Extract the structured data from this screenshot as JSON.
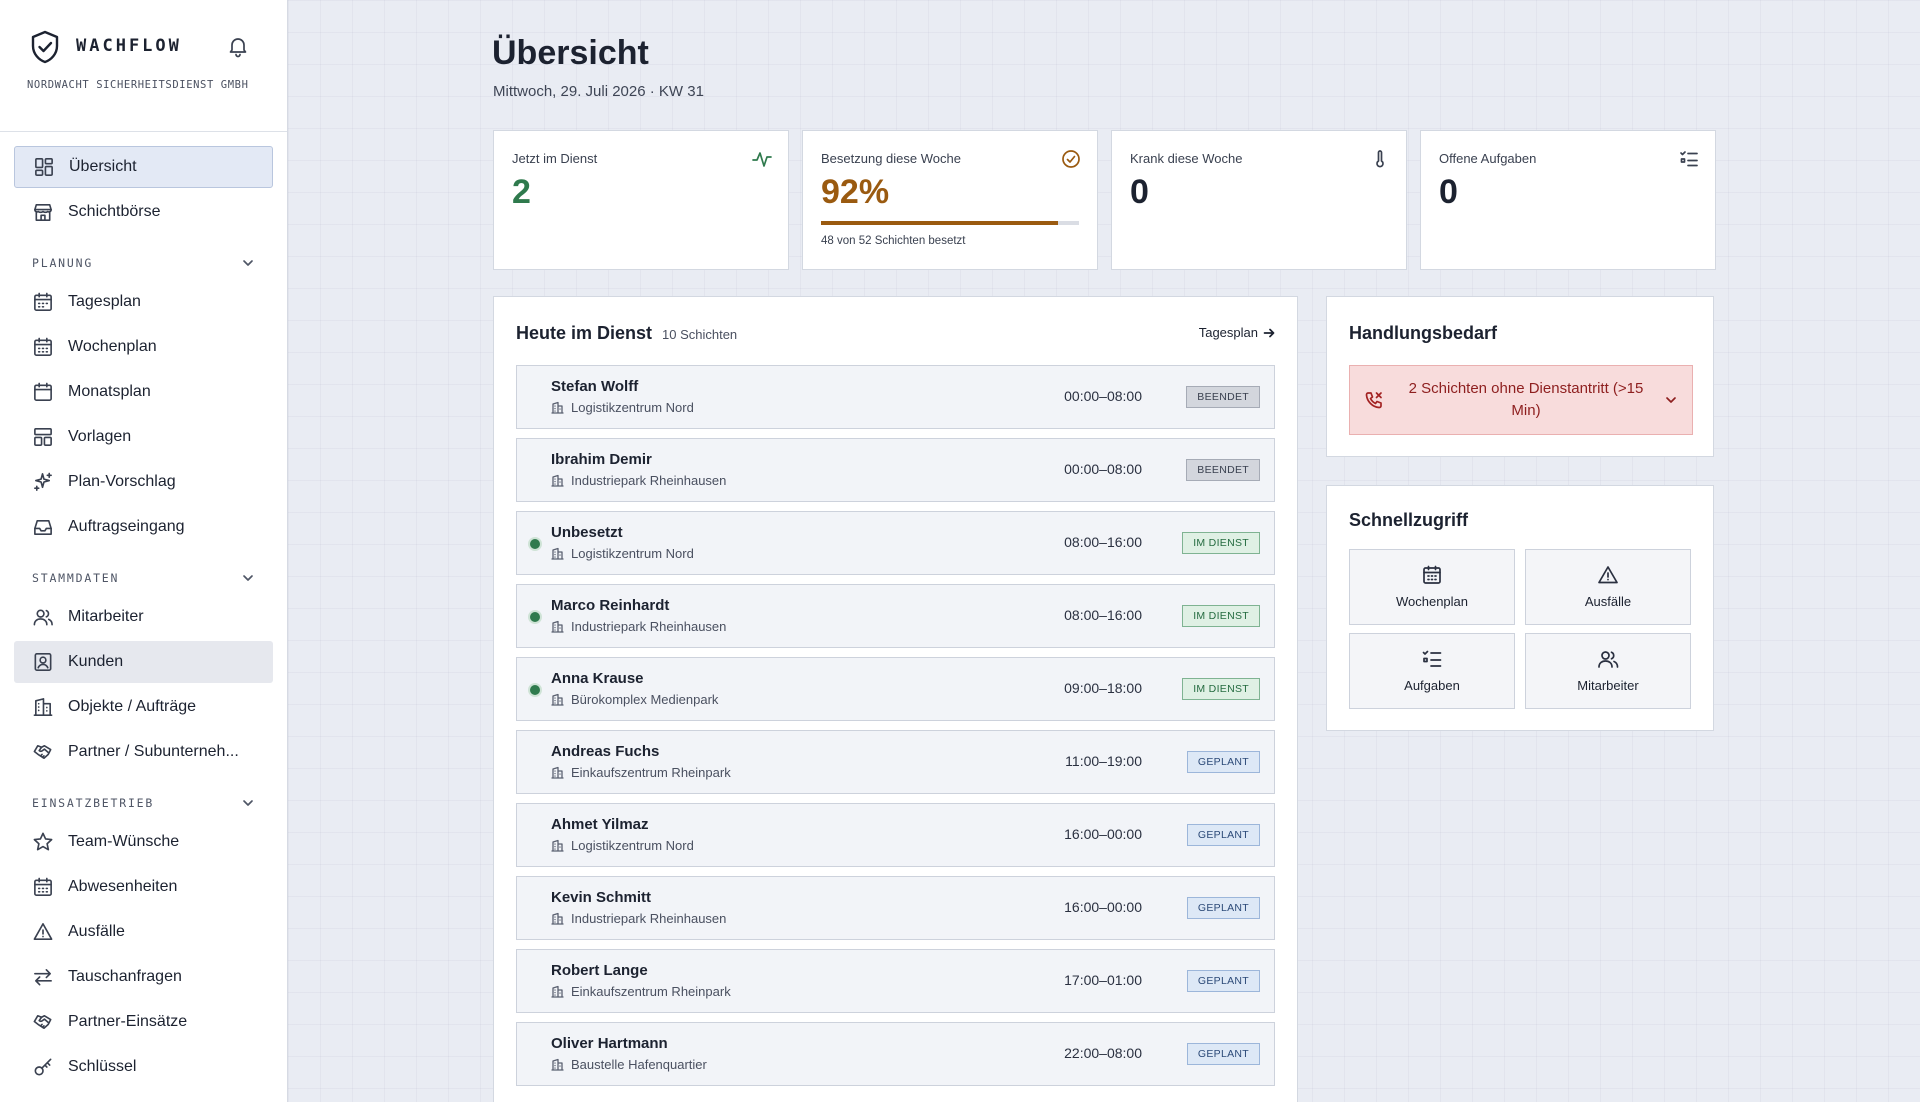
{
  "brand": {
    "name": "WACHFLOW",
    "company": "NORDWACHT SICHERHEITSDIENST GMBH",
    "logo_icon": "shield-check-icon",
    "notifications_icon": "bell-icon"
  },
  "sidebar": {
    "top_items": [
      {
        "label": "Übersicht",
        "icon": "dashboard-icon",
        "state": "active"
      },
      {
        "label": "Schichtbörse",
        "icon": "store-icon",
        "state": ""
      }
    ],
    "sections": [
      {
        "title": "PLANUNG",
        "items": [
          {
            "label": "Tagesplan",
            "icon": "calendar-day-icon"
          },
          {
            "label": "Wochenplan",
            "icon": "calendar-week-icon"
          },
          {
            "label": "Monatsplan",
            "icon": "calendar-month-icon"
          },
          {
            "label": "Vorlagen",
            "icon": "template-icon"
          },
          {
            "label": "Plan-Vorschlag",
            "icon": "sparkles-icon"
          },
          {
            "label": "Auftragseingang",
            "icon": "inbox-icon"
          }
        ]
      },
      {
        "title": "STAMMDATEN",
        "items": [
          {
            "label": "Mitarbeiter",
            "icon": "users-icon"
          },
          {
            "label": "Kunden",
            "icon": "contact-icon",
            "state": "selected"
          },
          {
            "label": "Objekte / Aufträge",
            "icon": "building-icon"
          },
          {
            "label": "Partner / Subunterneh...",
            "icon": "handshake-icon"
          }
        ]
      },
      {
        "title": "EINSATZBETRIEB",
        "items": [
          {
            "label": "Team-Wünsche",
            "icon": "star-icon"
          },
          {
            "label": "Abwesenheiten",
            "icon": "calendar-absence-icon"
          },
          {
            "label": "Ausfälle",
            "icon": "warning-icon"
          },
          {
            "label": "Tauschanfragen",
            "icon": "swap-icon"
          },
          {
            "label": "Partner-Einsätze",
            "icon": "handshake-icon"
          },
          {
            "label": "Schlüssel",
            "icon": "key-icon"
          }
        ]
      }
    ]
  },
  "header": {
    "title": "Übersicht",
    "date": "Mittwoch, 29. Juli 2026 · KW 31"
  },
  "stats": [
    {
      "label": "Jetzt im Dienst",
      "value": "2",
      "icon": "activity-icon",
      "color": "#2f7a4d"
    },
    {
      "label": "Besetzung diese Woche",
      "value": "92%",
      "icon": "check-circle-icon",
      "color": "#9a5a10",
      "progress": 0.92,
      "sub": "48 von 52 Schichten besetzt"
    },
    {
      "label": "Krank diese Woche",
      "value": "0",
      "icon": "thermometer-icon",
      "color": "#1c2230"
    },
    {
      "label": "Offene Aufgaben",
      "value": "0",
      "icon": "task-list-icon",
      "color": "#1c2230"
    }
  ],
  "duty": {
    "title": "Heute im Dienst",
    "count": "10 Schichten",
    "link": "Tagesplan",
    "shifts": [
      {
        "name": "Stefan Wolff",
        "location": "Logistikzentrum Nord",
        "time": "00:00–08:00",
        "status": "BEENDET",
        "status_key": "beendet",
        "active": false
      },
      {
        "name": "Ibrahim Demir",
        "location": "Industriepark Rheinhausen",
        "time": "00:00–08:00",
        "status": "BEENDET",
        "status_key": "beendet",
        "active": false
      },
      {
        "name": "Unbesetzt",
        "location": "Logistikzentrum Nord",
        "time": "08:00–16:00",
        "status": "IM DIENST",
        "status_key": "imdienst",
        "active": true
      },
      {
        "name": "Marco Reinhardt",
        "location": "Industriepark Rheinhausen",
        "time": "08:00–16:00",
        "status": "IM DIENST",
        "status_key": "imdienst",
        "active": true
      },
      {
        "name": "Anna Krause",
        "location": "Bürokomplex Medienpark",
        "time": "09:00–18:00",
        "status": "IM DIENST",
        "status_key": "imdienst",
        "active": true
      },
      {
        "name": "Andreas Fuchs",
        "location": "Einkaufszentrum Rheinpark",
        "time": "11:00–19:00",
        "status": "GEPLANT",
        "status_key": "geplant",
        "active": false
      },
      {
        "name": "Ahmet Yilmaz",
        "location": "Logistikzentrum Nord",
        "time": "16:00–00:00",
        "status": "GEPLANT",
        "status_key": "geplant",
        "active": false
      },
      {
        "name": "Kevin Schmitt",
        "location": "Industriepark Rheinhausen",
        "time": "16:00–00:00",
        "status": "GEPLANT",
        "status_key": "geplant",
        "active": false
      },
      {
        "name": "Robert Lange",
        "location": "Einkaufszentrum Rheinpark",
        "time": "17:00–01:00",
        "status": "GEPLANT",
        "status_key": "geplant",
        "active": false
      },
      {
        "name": "Oliver Hartmann",
        "location": "Baustelle Hafenquartier",
        "time": "22:00–08:00",
        "status": "GEPLANT",
        "status_key": "geplant",
        "active": false
      }
    ]
  },
  "action": {
    "title": "Handlungsbedarf",
    "alert": "2 Schichten ohne Dienstantritt (>15 Min)",
    "alert_icon": "phone-missed-icon"
  },
  "quick": {
    "title": "Schnellzugriff",
    "tiles": [
      {
        "label": "Wochenplan",
        "icon": "calendar-week-icon"
      },
      {
        "label": "Ausfälle",
        "icon": "warning-icon"
      },
      {
        "label": "Aufgaben",
        "icon": "task-list-icon"
      },
      {
        "label": "Mitarbeiter",
        "icon": "users-icon"
      }
    ]
  }
}
